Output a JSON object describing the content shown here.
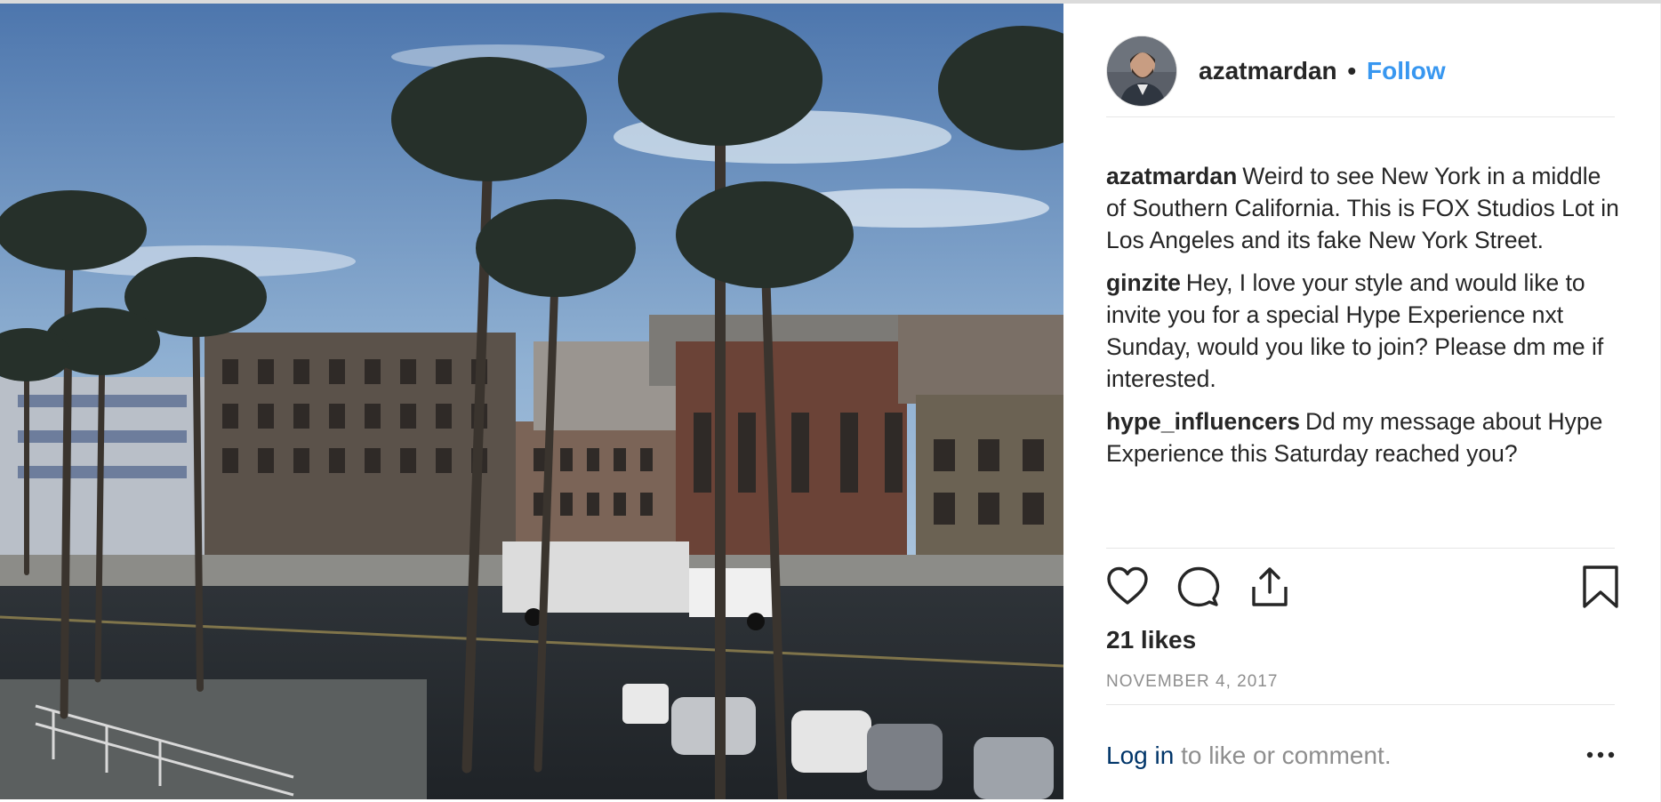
{
  "post": {
    "author": "azatmardan",
    "follow_label": "Follow",
    "separator": "•",
    "avatar_icon": "avatar-photo",
    "photo_icon": "palm-trees-city-street-photo"
  },
  "comments": [
    {
      "username": "azatmardan",
      "text": "Weird to see New York in a middle of Southern California. This is FOX Studios Lot in Los Angeles and its fake New York Street."
    },
    {
      "username": "ginzite",
      "text": "Hey, I love your style and would like to invite you for a special Hype Experience nxt Sunday, would you like to join? Please dm me if interested."
    },
    {
      "username": "hype_influencers",
      "text": "Dd my message about Hype Experience this Saturday reached you?"
    }
  ],
  "actions": {
    "like_icon": "heart-icon",
    "comment_icon": "comment-bubble-icon",
    "share_icon": "share-icon",
    "save_icon": "bookmark-icon"
  },
  "likes": "21 likes",
  "date": "NOVEMBER 4, 2017",
  "login": {
    "link": "Log in",
    "text": "to like or comment."
  },
  "more_icon": "more-options-icon",
  "colors": {
    "link": "#3897f0",
    "login_link": "#003569",
    "muted": "#8e8e8e",
    "text": "#262626"
  }
}
